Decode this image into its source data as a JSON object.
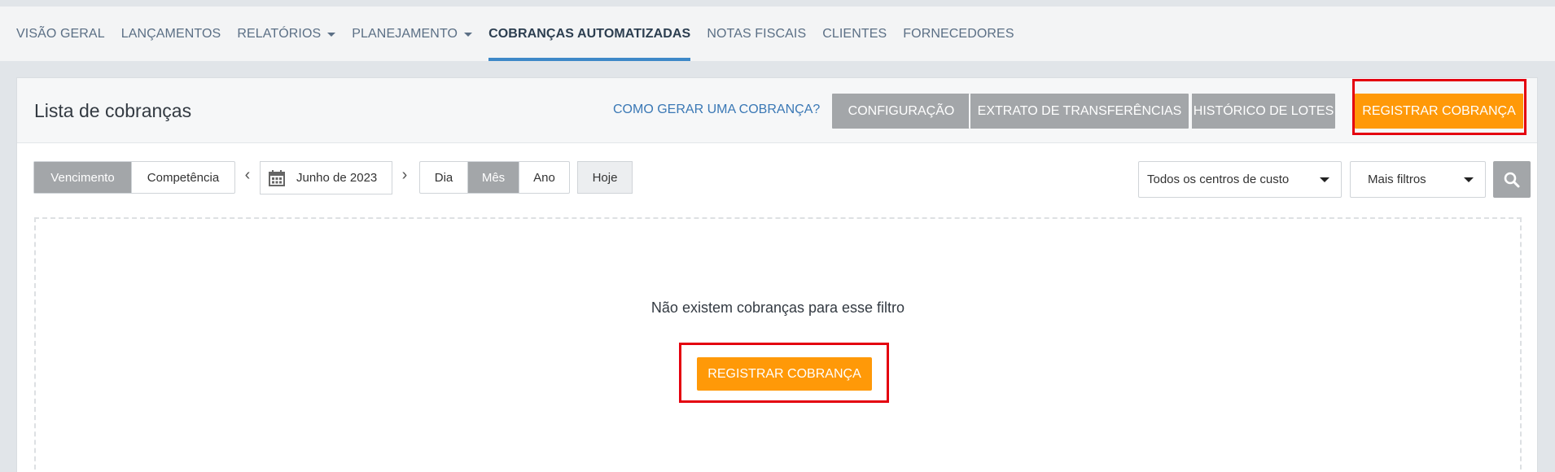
{
  "nav": {
    "items": [
      {
        "label": "VISÃO GERAL",
        "dropdown": false,
        "active": false
      },
      {
        "label": "LANÇAMENTOS",
        "dropdown": false,
        "active": false
      },
      {
        "label": "RELATÓRIOS",
        "dropdown": true,
        "active": false
      },
      {
        "label": "PLANEJAMENTO",
        "dropdown": true,
        "active": false
      },
      {
        "label": "COBRANÇAS AUTOMATIZADAS",
        "dropdown": false,
        "active": true
      },
      {
        "label": "NOTAS FISCAIS",
        "dropdown": false,
        "active": false
      },
      {
        "label": "CLIENTES",
        "dropdown": false,
        "active": false
      },
      {
        "label": "FORNECEDORES",
        "dropdown": false,
        "active": false
      }
    ]
  },
  "header": {
    "title": "Lista de cobranças",
    "help_link": "COMO GERAR UMA COBRANÇA?",
    "buttons": {
      "config": "CONFIGURAÇÃO",
      "extrato": "EXTRATO DE TRANSFERÊNCIAS",
      "historico": "HISTÓRICO DE LOTES",
      "registrar": "REGISTRAR COBRANÇA"
    }
  },
  "filters": {
    "date_type": {
      "options": [
        "Vencimento",
        "Competência"
      ],
      "selected": "Vencimento"
    },
    "period_label": "Junho de 2023",
    "granularity": {
      "options": [
        "Dia",
        "Mês",
        "Ano"
      ],
      "selected": "Mês"
    },
    "today": "Hoje",
    "cost_center": "Todos os centros de custo",
    "more_filters": "Mais filtros"
  },
  "empty_state": {
    "message": "Não existem cobranças para esse filtro",
    "button": "REGISTRAR COBRANÇA"
  },
  "colors": {
    "accent_orange": "#ff9908",
    "button_gray": "#a3a6a9",
    "active_underline": "#3d88c8",
    "highlight_red": "#e4000f",
    "link_blue": "#3a78b5"
  },
  "icons": {
    "calendar": "calendar-icon",
    "prev": "chevron-left-icon",
    "next": "chevron-right-icon",
    "search": "search-icon",
    "dropdown": "caret-down-icon"
  }
}
